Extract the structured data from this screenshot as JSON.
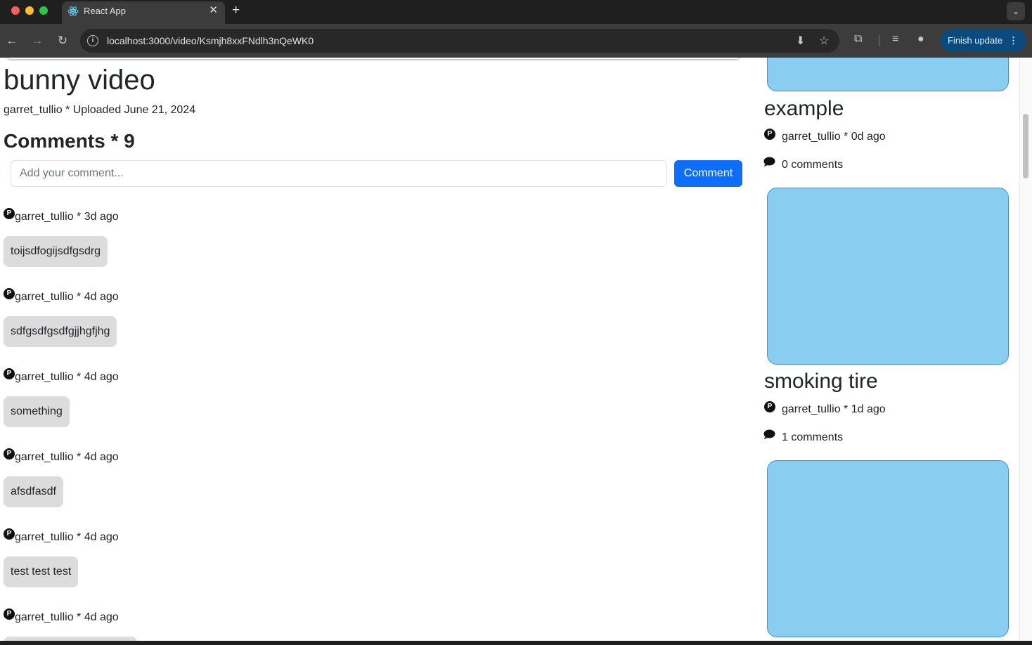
{
  "browser": {
    "tab_title": "React App",
    "url": "localhost:3000/video/Ksmjh8xxFNdlh3nQeWK0",
    "finish_update_label": "Finish update"
  },
  "video": {
    "title": "bunny video",
    "meta": "garret_tullio * Uploaded June 21, 2024"
  },
  "comments": {
    "heading": "Comments * 9",
    "input_placeholder": "Add your comment...",
    "submit_label": "Comment",
    "items": [
      {
        "avatar": "P",
        "author": "garret_tullio * 3d ago",
        "text": "toijsdfogijsdfgsdrg"
      },
      {
        "avatar": "P",
        "author": "garret_tullio * 4d ago",
        "text": "sdfgsdfgsdfgjjhgfjhg"
      },
      {
        "avatar": "P",
        "author": "garret_tullio * 4d ago",
        "text": "something"
      },
      {
        "avatar": "P",
        "author": "garret_tullio * 4d ago",
        "text": "afsdfasdf"
      },
      {
        "avatar": "P",
        "author": "garret_tullio * 4d ago",
        "text": "test test test"
      },
      {
        "avatar": "P",
        "author": "garret_tullio * 4d ago",
        "text": ""
      }
    ]
  },
  "sidebar": {
    "thumbnail_color": "#89cdf0",
    "videos": [
      {
        "title": "example",
        "avatar": "P",
        "meta": "garret_tullio * 0d ago",
        "comments": "0 comments"
      },
      {
        "title": "smoking tire",
        "avatar": "P",
        "meta": "garret_tullio * 1d ago",
        "comments": "1 comments"
      }
    ]
  },
  "colors": {
    "primary": "#0d6efd",
    "bubble": "#dcdcdc",
    "update_button": "#0b4a7d"
  },
  "icons": [
    "react-icon",
    "close-icon",
    "plus-icon",
    "chevron-down-icon",
    "back-icon",
    "forward-icon",
    "reload-icon",
    "info-icon",
    "install-icon",
    "star-icon",
    "extensions-icon",
    "media-icon",
    "profile-icon",
    "more-icon",
    "comment-bubble-icon"
  ]
}
